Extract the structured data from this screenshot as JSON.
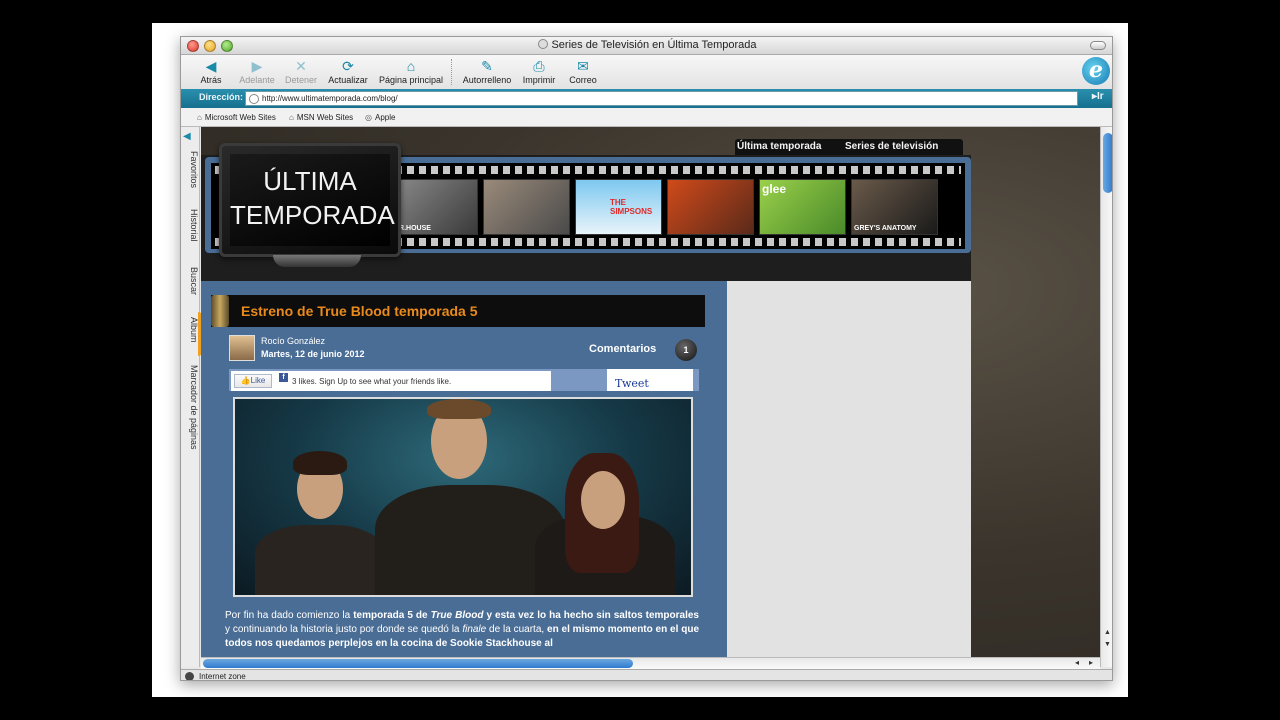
{
  "window": {
    "title": "Series de Televisión en Última Temporada"
  },
  "toolbar": {
    "buttons": [
      {
        "label": "Atrás",
        "icon": "back-arrow-icon",
        "enabled": true
      },
      {
        "label": "Adelante",
        "icon": "forward-arrow-icon",
        "enabled": false
      },
      {
        "label": "Detener",
        "icon": "stop-icon",
        "enabled": false
      },
      {
        "label": "Actualizar",
        "icon": "refresh-icon",
        "enabled": true
      },
      {
        "label": "Página principal",
        "icon": "home-icon",
        "enabled": true
      },
      {
        "label": "Autorrelleno",
        "icon": "autofill-icon",
        "enabled": true
      },
      {
        "label": "Imprimir",
        "icon": "print-icon",
        "enabled": true
      },
      {
        "label": "Correo",
        "icon": "mail-icon",
        "enabled": true
      }
    ]
  },
  "address": {
    "label": "Dirección:",
    "url": "http://www.ultimatemporada.com/blog/",
    "go_label": "Ir"
  },
  "favorites_bar": {
    "items": [
      "Microsoft Web Sites",
      "MSN Web Sites",
      "Apple"
    ]
  },
  "side_tabs": [
    "Favoritos",
    "Historial",
    "Buscar",
    "Álbum",
    "Marcador de páginas"
  ],
  "site": {
    "nav": [
      "Última temporada",
      "Series de televisión"
    ],
    "logo_line1": "ÚLTIMA",
    "logo_line2": "TEMPORADA",
    "strip_labels": [
      "DR.HOUSE",
      "",
      "THE SIMPSONS",
      "",
      "glee",
      "GREY'S ANATOMY"
    ]
  },
  "post": {
    "title": "Estreno de True Blood temporada 5",
    "author": "Rocío González",
    "date": "Martes, 12 de junio 2012",
    "comments_label": "Comentarios",
    "comments_count": "1",
    "like_label": "Like",
    "like_text": "3 likes. Sign Up to see what your friends like.",
    "tweet_label": "Tweet",
    "body_parts": [
      {
        "t": "Por fin ha dado comienzo la ",
        "s": "n"
      },
      {
        "t": "temporada 5 de ",
        "s": "b"
      },
      {
        "t": "True Blood",
        "s": "bi"
      },
      {
        "t": " y esta vez lo ha hecho sin saltos temporales",
        "s": "b"
      },
      {
        "t": " y continuando la historia justo por donde se quedó la ",
        "s": "n"
      },
      {
        "t": "finale",
        "s": "i"
      },
      {
        "t": " de la cuarta, ",
        "s": "n"
      },
      {
        "t": "en el mismo momento en el que todos nos quedamos perplejos en la cocina de Sookie Stackhouse al",
        "s": "b"
      }
    ]
  },
  "status": {
    "text": "Internet zone"
  },
  "colors": {
    "accent": "#1a8aa8",
    "post_title": "#e98a1c",
    "site_blue": "#4a6d96"
  }
}
